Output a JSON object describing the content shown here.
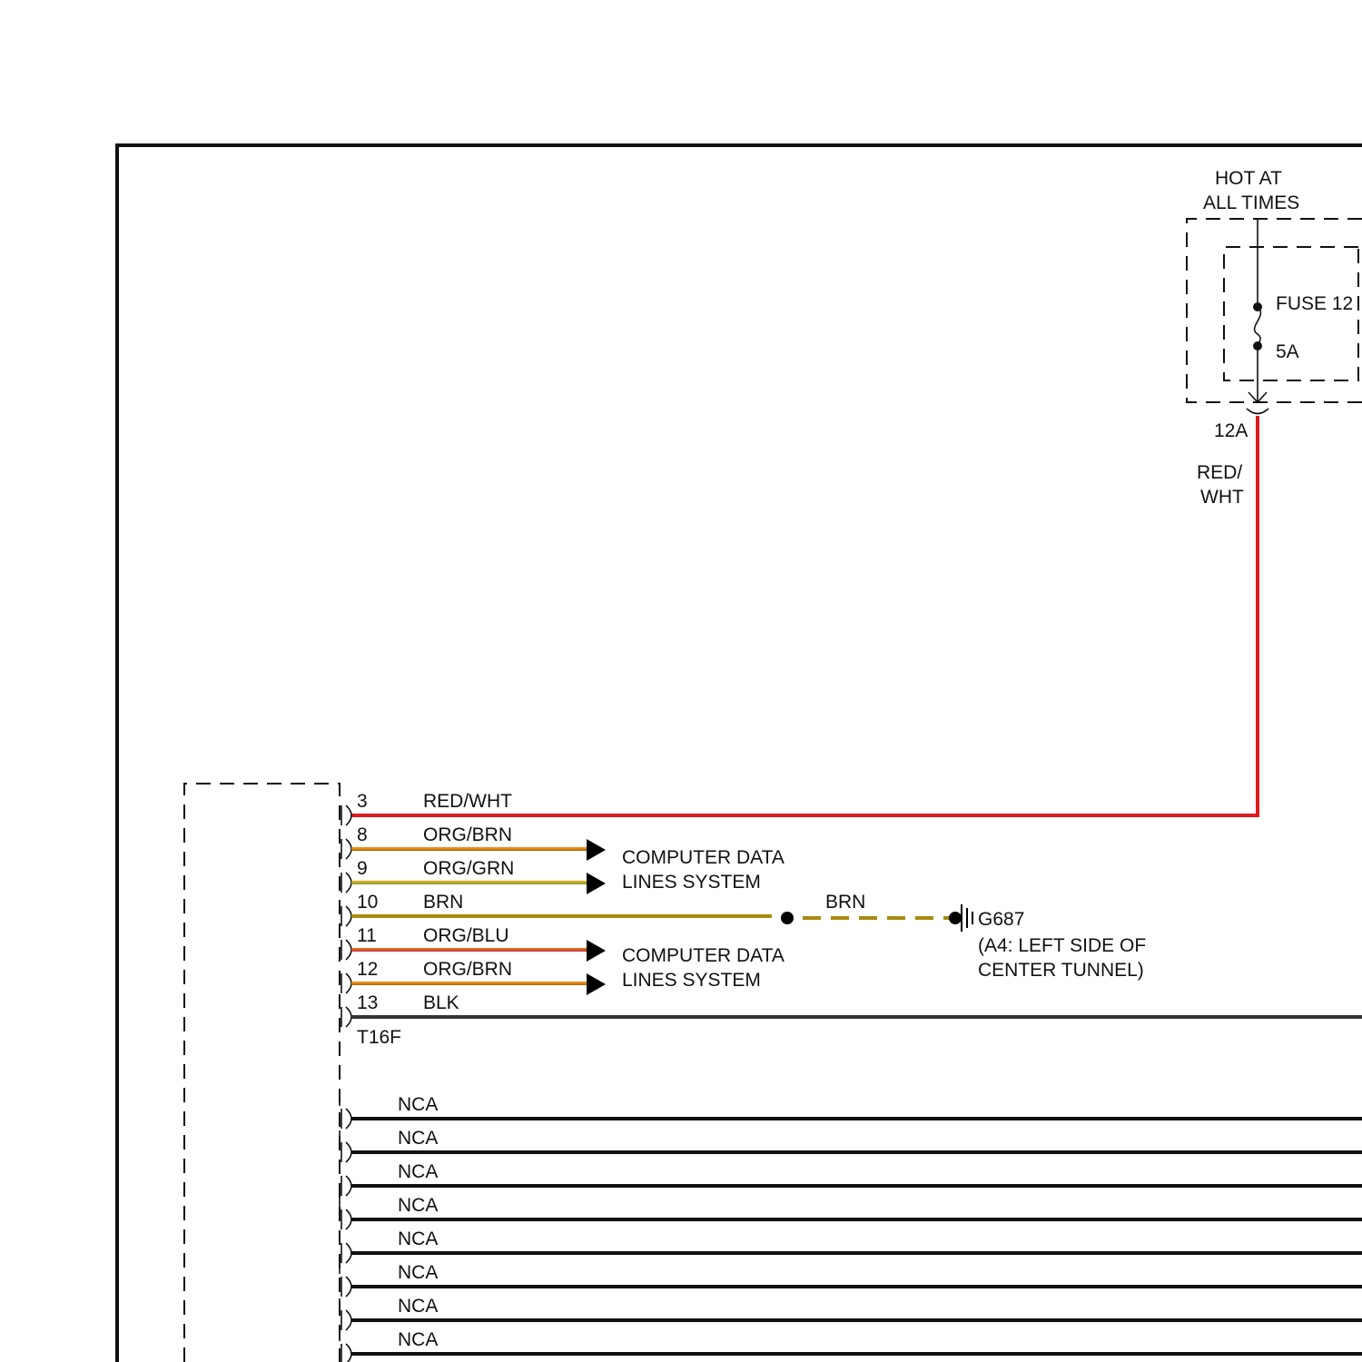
{
  "power": {
    "hot_line1": "HOT AT",
    "hot_line2": "ALL TIMES",
    "fuse_name": "FUSE 12",
    "fuse_rating": "5A",
    "terminal": "12A",
    "wire_color_line1": "RED/",
    "wire_color_line2": "WHT"
  },
  "connector": {
    "name": "T16F",
    "pins": [
      {
        "pin": "3",
        "color": "RED/WHT",
        "stroke": "#e01b1b",
        "stripe": "#ffffff"
      },
      {
        "pin": "8",
        "color": "ORG/BRN",
        "stroke": "#f08c1a",
        "stripe": "#9a6b00"
      },
      {
        "pin": "9",
        "color": "ORG/GRN",
        "stroke": "#f0a01a",
        "stripe": "#58b030"
      },
      {
        "pin": "10",
        "color": "BRN",
        "stroke": "#a88a10",
        "stripe": ""
      },
      {
        "pin": "11",
        "color": "ORG/BLU",
        "stroke": "#e06a1a",
        "stripe": "#c03050"
      },
      {
        "pin": "12",
        "color": "ORG/BRN",
        "stroke": "#f08c1a",
        "stripe": "#9a6b00"
      },
      {
        "pin": "13",
        "color": "BLK",
        "stroke": "#333333",
        "stripe": ""
      }
    ]
  },
  "data_lines": {
    "group1_line1": "COMPUTER DATA",
    "group1_line2": "LINES SYSTEM",
    "group2_line1": "COMPUTER DATA",
    "group2_line2": "LINES SYSTEM"
  },
  "ground": {
    "wire_color": "BRN",
    "id": "G687",
    "location_line1": "(A4: LEFT SIDE OF",
    "location_line2": "CENTER TUNNEL)"
  },
  "nca": {
    "labels": [
      "NCA",
      "NCA",
      "NCA",
      "NCA",
      "NCA",
      "NCA",
      "NCA",
      "NCA"
    ]
  }
}
